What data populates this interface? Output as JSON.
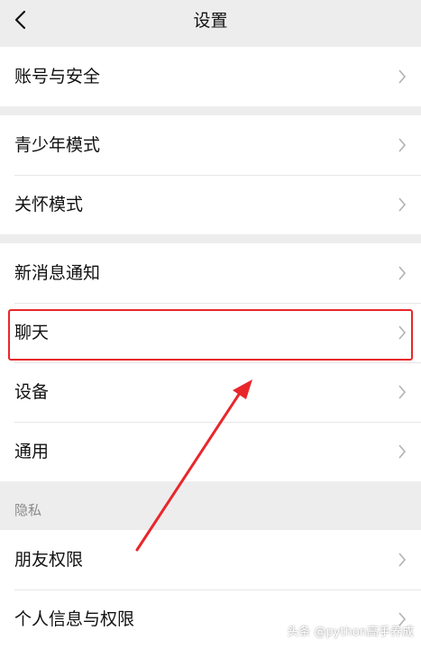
{
  "header": {
    "title": "设置",
    "back_icon": "chevron-left-icon"
  },
  "groups": [
    {
      "items": [
        {
          "label": "账号与安全"
        }
      ]
    },
    {
      "items": [
        {
          "label": "青少年模式"
        },
        {
          "label": "关怀模式"
        }
      ]
    },
    {
      "items": [
        {
          "label": "新消息通知"
        },
        {
          "label": "聊天"
        },
        {
          "label": "设备"
        },
        {
          "label": "通用"
        }
      ]
    },
    {
      "section_label": "隐私",
      "items": [
        {
          "label": "朋友权限"
        },
        {
          "label": "个人信息与权限"
        }
      ]
    }
  ],
  "annotation": {
    "color": "#e8272b",
    "highlighted_item": "聊天"
  },
  "watermark": "头条 @python高手养成",
  "colors": {
    "background": "#ededed",
    "row": "#ffffff",
    "text": "#111111",
    "muted": "#8a8a8a",
    "chevron": "#b2b2b2"
  }
}
